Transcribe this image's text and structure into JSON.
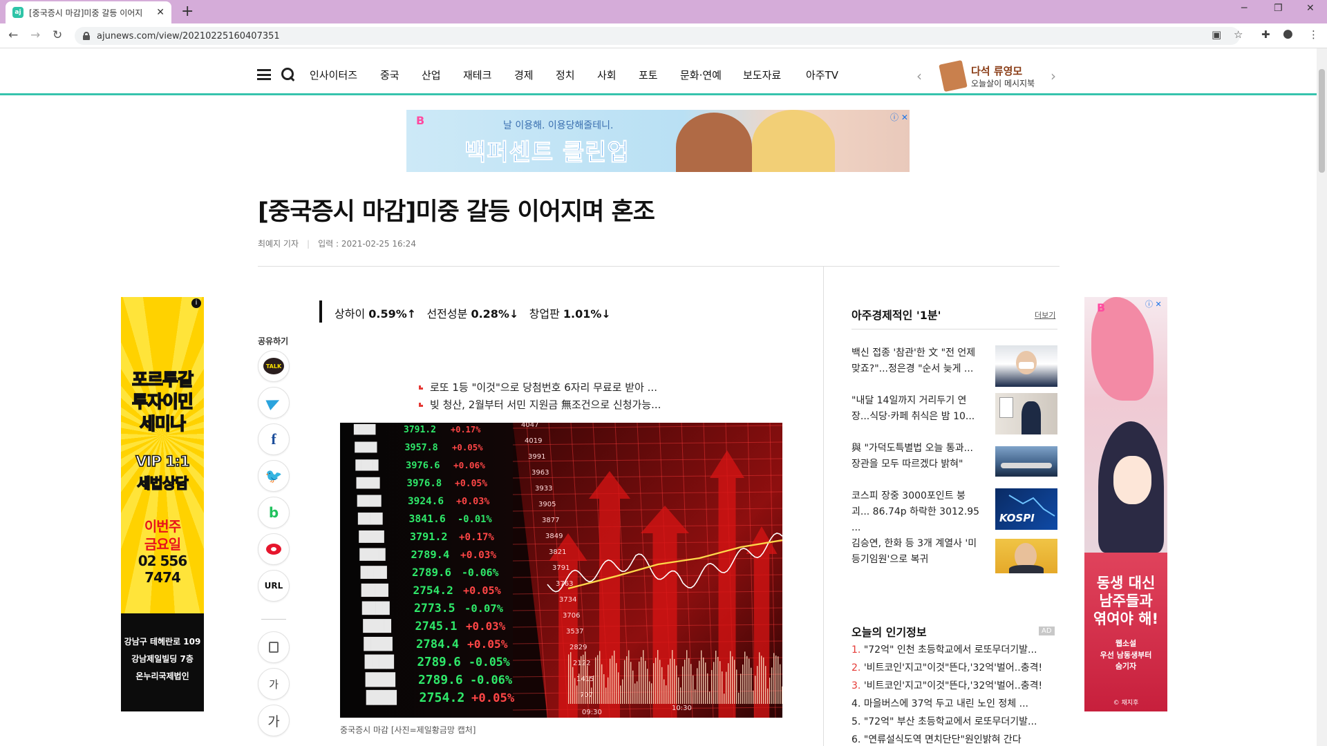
{
  "browser": {
    "tab_title": "[중국증시 마감]미중 갈등 이어지",
    "tab_close": "✕",
    "new_tab": "+",
    "url": "ajunews.com/view/20210225160407351",
    "win_min": "─",
    "win_max": "❐",
    "win_close": "✕",
    "back": "←",
    "forward": "→",
    "reload": "↻"
  },
  "nav": {
    "items": [
      "인사이터즈",
      "중국",
      "산업",
      "재테크",
      "경제",
      "정치",
      "사회",
      "포토",
      "문화·연예",
      "보도자료",
      "아주TV"
    ],
    "promo_title": "다석 류영모",
    "promo_subtitle": "오늘살이 메시지북",
    "prev": "‹",
    "next": "›"
  },
  "top_banner": {
    "brand": "B",
    "tagline": "날 이용해. 이용당해줄테니.",
    "title": "백퍼센트 클린업"
  },
  "article": {
    "headline": "[중국증시 마감]미중 갈등 이어지며 혼조",
    "author": "최예지 기자",
    "date": "입력 : 2021-02-25 16:24",
    "summary": [
      {
        "label": "상하이",
        "value": "0.59%↑"
      },
      {
        "label": "선전성분",
        "value": "0.28%↓"
      },
      {
        "label": "창업판",
        "value": "1.01%↓"
      }
    ],
    "related": [
      "로또 1등 \"이것\"으로 당첨번호 6자리 무료로 받아 ...",
      "빚 청산, 2월부터 서민 지원금 無조건으로 신청가능..."
    ],
    "caption": "중국증시 마감 [사진=제일황금망 캡처]",
    "photo_left_numbers": [
      "3791.2",
      "3957.8",
      "3976.6",
      "3976.8",
      "3924.6",
      "3841.6",
      "3791.2",
      "2789.4",
      "2789.6",
      "2754.2",
      "2773.5",
      "2745.1",
      "2784.4",
      "2789.6",
      "2789.6",
      "2754.2"
    ],
    "photo_pct": [
      "+0.17%",
      "+0.05%",
      "+0.06%",
      "+0.05%",
      "+0.03%",
      "-0.01%",
      "+0.17%",
      "+0.03%",
      "-0.06%",
      "+0.05%",
      "-0.07%",
      "+0.03%",
      "+0.05%",
      "-0.05%",
      "-0.06%",
      "+0.05%"
    ],
    "photo_axis": [
      "4047",
      "4019",
      "3991",
      "3963",
      "3933",
      "3905",
      "3877",
      "3849",
      "3821",
      "3791",
      "3763",
      "3734",
      "3706",
      "3537",
      "2829",
      "2122",
      "1415",
      "707"
    ],
    "photo_times": [
      "09:30",
      "10:30"
    ]
  },
  "share": {
    "label": "공유하기",
    "kakao": "TALK",
    "facebook": "f",
    "twitter": "🐦",
    "band": "b",
    "url": "URL",
    "font_small": "가",
    "font_large": "가"
  },
  "left_ad": {
    "info": "i",
    "lines": [
      "포르투갈",
      "투자이민",
      "세미나",
      "VIP 1:1",
      "세법상담",
      "이번주",
      "금요일",
      "02 556 7474"
    ],
    "address": [
      "강남구 테헤란로 109",
      "강남제일빌딩 7층",
      "온누리국제법인"
    ]
  },
  "right_column": {
    "title": "아주경제적인 '1분'",
    "more": "더보기",
    "items": [
      "백신 접종 '참관'한 文 \"전 언제 맞죠?\"...정은경 \"순서 늦게 ...",
      "\"내달 14일까지 거리두기 연장...식당·카페 취식은 밤 10...",
      "與 \"가덕도특별법 오늘 통과... 장관을 모두 따르겠다 밝혀\"",
      "코스피 장중 3000포인트 붕괴... 86.74p 하락한 3012.95 ...",
      "김승연, 한화 등 3개 계열사 '미등기임원'으로 복귀"
    ],
    "kospi_thumb": "KOSPI",
    "popular_title": "오늘의 인기정보",
    "popular_ad": "AD",
    "popular": [
      {
        "num": "1.",
        "text": "\"72억\" 인천 초등학교에서 로또무더기발..."
      },
      {
        "num": "2.",
        "text": "'비트코인'지고\"이것\"뜬다,'32억'벌어..충격!"
      },
      {
        "num": "3.",
        "text": "'비트코인'지고\"이것\"뜬다,'32억'벌어..충격!"
      },
      {
        "num": "4.",
        "text": "마을버스에 37억 두고 내린 노인 정체 ..."
      },
      {
        "num": "5.",
        "text": "\"72억\" 부산 초등학교에서 로또무더기발..."
      },
      {
        "num": "6.",
        "text": "\"연류설식도역 면치단단\"원인밝혀 간다"
      }
    ]
  },
  "right_ad": {
    "brand": "B",
    "info": "ⓘ ✕",
    "lines": [
      "동생 대신",
      "남주들과",
      "엮여야 해!"
    ],
    "sub": [
      "웹소설",
      "우선 남동생부터",
      "숨기자"
    ],
    "copyright": "© 채지후"
  },
  "colors": {
    "accent": "#36c3ad",
    "tab_bar": "#d5acd9",
    "up_red": "#e53935"
  }
}
